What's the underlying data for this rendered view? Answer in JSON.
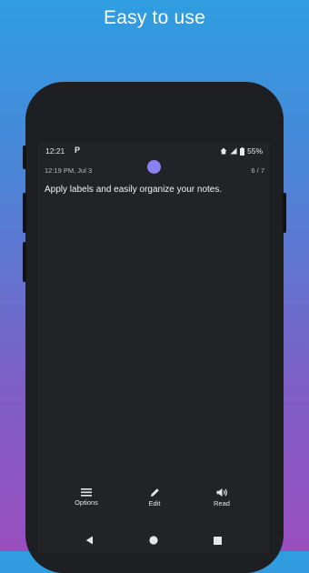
{
  "headline": "Easy to use",
  "status_bar": {
    "time": "12:21",
    "app_indicator": "P",
    "battery": "55%",
    "icons": [
      "home-icon",
      "signal-icon",
      "battery-icon"
    ]
  },
  "note": {
    "timestamp": "12:19 PM, Jul 3",
    "page_counter": "6 / 7",
    "text": "Apply labels and easily organize your notes."
  },
  "actions": {
    "options_label": "Options",
    "edit_label": "Edit",
    "read_label": "Read"
  },
  "navigation": {
    "buttons": [
      "back-icon",
      "home-icon",
      "recents-icon"
    ]
  },
  "colors": {
    "accent": "#8b80f0",
    "screen_bg": "#222327",
    "phone_body": "#1e1f22"
  }
}
